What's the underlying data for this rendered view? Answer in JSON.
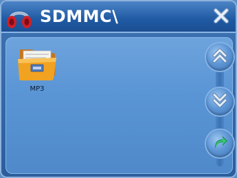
{
  "window": {
    "title": "SDMMC\\"
  },
  "icons": {
    "app": "headphones-icon",
    "close": "close-icon",
    "folder": "folder-icon",
    "up": "double-chevron-up-icon",
    "down": "double-chevron-down-icon",
    "back": "back-arrow-icon"
  },
  "files": [
    {
      "label": "MP3",
      "type": "folder"
    }
  ],
  "colors": {
    "titlebar": "#1f5aa3",
    "content_bg": "#5a95d5",
    "folder_orange": "#f0a020",
    "back_arrow_green": "#2fb26a"
  }
}
